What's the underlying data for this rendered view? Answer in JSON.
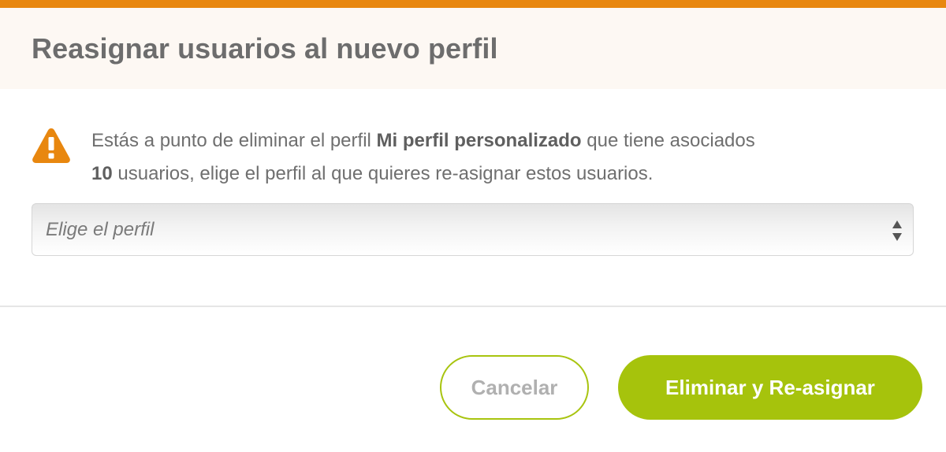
{
  "dialog": {
    "title": "Reasignar usuarios al nuevo perfil",
    "accent_color": "#e8870f",
    "header_bg": "#fdf8f3"
  },
  "warning": {
    "icon": "warning-triangle-icon",
    "icon_color": "#e8870f",
    "text_prefix": "Estás a punto de eliminar el perfil ",
    "profile_name": "Mi perfil personalizado",
    "text_middle": " que tiene asociados ",
    "user_count": "10",
    "text_suffix": " usuarios, elige el perfil al que quieres re-asignar estos usuarios."
  },
  "profile_select": {
    "placeholder": "Elige el perfil",
    "arrows_icon": "select-arrows-icon"
  },
  "buttons": {
    "cancel_label": "Cancelar",
    "confirm_label": "Eliminar y Re-asignar",
    "confirm_color": "#a6c30c"
  }
}
